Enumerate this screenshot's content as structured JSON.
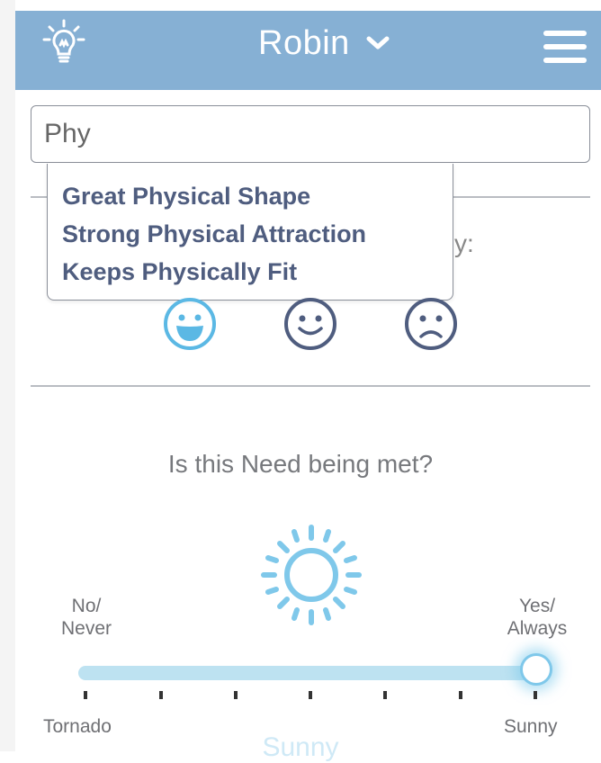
{
  "header": {
    "user_name": "Robin",
    "logo_icon": "lightbulb-icon",
    "menu_icon": "hamburger-menu-icon",
    "dropdown_icon": "chevron-down-icon",
    "background_color": "#86b0d4"
  },
  "search": {
    "value": "Phy"
  },
  "suggestions": [
    "Great Physical Shape",
    "Strong Physical Attraction",
    "Keeps Physically Fit"
  ],
  "obscured_text": "y:",
  "faces": [
    {
      "icon": "laughing-face-icon",
      "selected": true
    },
    {
      "icon": "smiling-face-icon",
      "selected": false
    },
    {
      "icon": "sad-face-icon",
      "selected": false
    }
  ],
  "need": {
    "question": "Is this Need being met?",
    "icon": "sun-icon",
    "left_label_line1": "No/",
    "left_label_line2": "Never",
    "right_label_line1": "Yes/",
    "right_label_line2": "Always",
    "scale_min_label": "Tornado",
    "scale_max_label": "Sunny",
    "current_value_label": "Sunny",
    "slider_position": 1.0,
    "slider_steps": 7,
    "accent_color": "#5bb8e4"
  }
}
